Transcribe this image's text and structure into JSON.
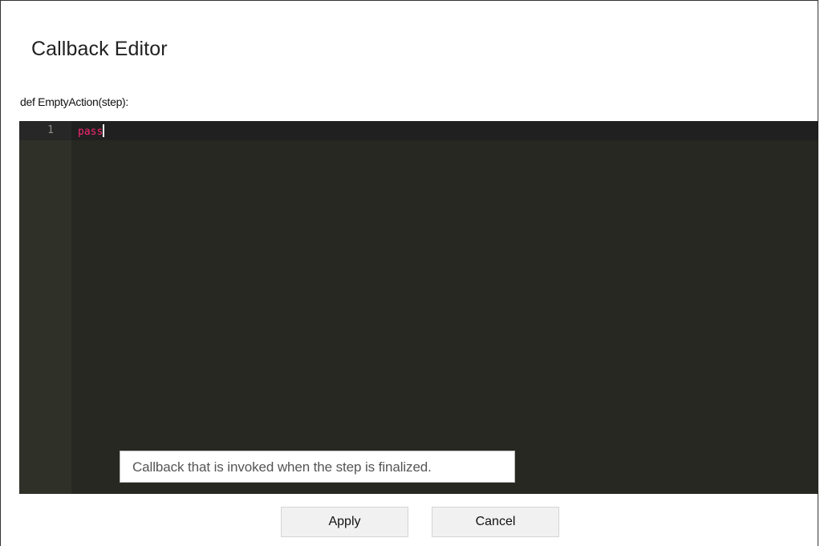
{
  "dialog": {
    "title": "Callback Editor",
    "signature": "def EmptyAction(step):"
  },
  "editor": {
    "lines": [
      {
        "number": "1",
        "code": "pass"
      }
    ],
    "theme": {
      "background": "#272822",
      "gutter": "#2f3129",
      "keyword_color": "#f92672"
    }
  },
  "tooltip": {
    "text": "Callback that is invoked when the step is finalized."
  },
  "buttons": {
    "apply_label": "Apply",
    "cancel_label": "Cancel"
  }
}
